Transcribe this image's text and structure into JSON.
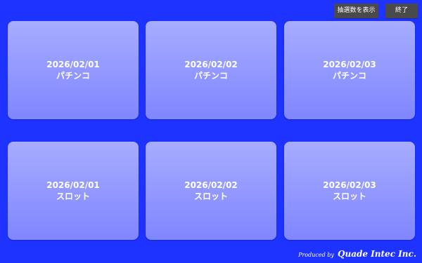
{
  "toolbar": {
    "show_count_label": "抽選数を表示",
    "end_label": "終了"
  },
  "cards": [
    {
      "date": "2026/02/01",
      "label": "パチンコ"
    },
    {
      "date": "2026/02/02",
      "label": "パチンコ"
    },
    {
      "date": "2026/02/03",
      "label": "パチンコ"
    },
    {
      "date": "2026/02/01",
      "label": "スロット"
    },
    {
      "date": "2026/02/02",
      "label": "スロット"
    },
    {
      "date": "2026/02/03",
      "label": "スロット"
    }
  ],
  "footer": {
    "produced_by": "Produced by",
    "company": "Quade Intec Inc."
  },
  "colors": {
    "background": "#1e33ff",
    "card_top": "#a7acff",
    "card_bottom": "#7f86ff",
    "button": "#4a4a4a"
  }
}
